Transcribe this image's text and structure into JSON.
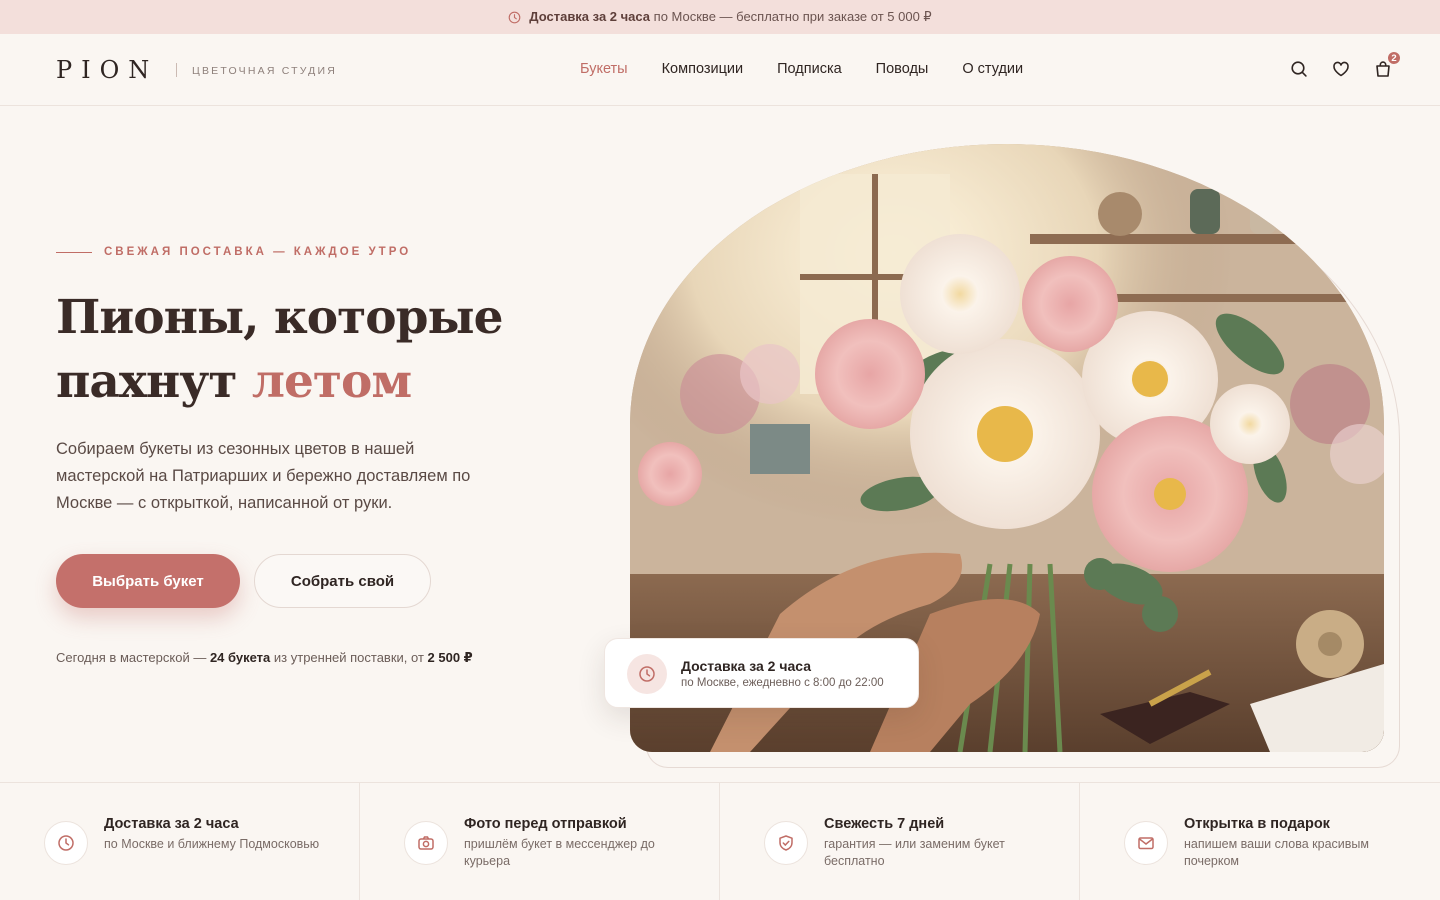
{
  "topbar": {
    "icon": "clock-icon",
    "bold": "Доставка за 2 часа",
    "rest": "по Москве — бесплатно при заказе от 5 000 ₽"
  },
  "header": {
    "logo": "PION",
    "tagline": "ЦВЕТОЧНАЯ СТУДИЯ",
    "nav": [
      {
        "label": "Букеты",
        "active": true
      },
      {
        "label": "Композиции",
        "active": false
      },
      {
        "label": "Подписка",
        "active": false
      },
      {
        "label": "Поводы",
        "active": false
      },
      {
        "label": "О студии",
        "active": false
      }
    ],
    "cart_count": "2"
  },
  "hero": {
    "eyebrow": "СВЕЖАЯ ПОСТАВКА — КАЖДОЕ УТРО",
    "title_line1": "Пионы, которые",
    "title_line2_plain": "пахнут ",
    "title_line2_accent": "летом",
    "description": "Собираем букеты из сезонных цветов в нашей мастерской на Патриарших и бережно доставляем по Москве — с открыткой, написанной от руки.",
    "primary_button": "Выбрать букет",
    "secondary_button": "Собрать свой",
    "today_prefix": "Сегодня в мастерской —",
    "today_count": "24 букета",
    "today_middle": "из утренней поставки, от",
    "today_price": "2 500 ₽"
  },
  "delivery_card": {
    "title": "Доставка за 2 часа",
    "subtitle": "по Москве, ежедневно с 8:00 до 22:00"
  },
  "features": [
    {
      "icon": "clock-icon",
      "title": "Доставка за 2 часа",
      "desc": "по Москве и ближнему Подмосковью"
    },
    {
      "icon": "camera-icon",
      "title": "Фото перед отправкой",
      "desc": "пришлём букет в мессенджер до курьера"
    },
    {
      "icon": "shield-icon",
      "title": "Свежесть 7 дней",
      "desc": "гарантия — или заменим букет бесплатно"
    },
    {
      "icon": "mail-icon",
      "title": "Открытка в подарок",
      "desc": "напишем ваши слова красивым почерком"
    }
  ],
  "colors": {
    "accent": "#c06d66",
    "background": "#faf6f2",
    "topbar": "#f3dfdb",
    "text": "#3a2b27"
  }
}
